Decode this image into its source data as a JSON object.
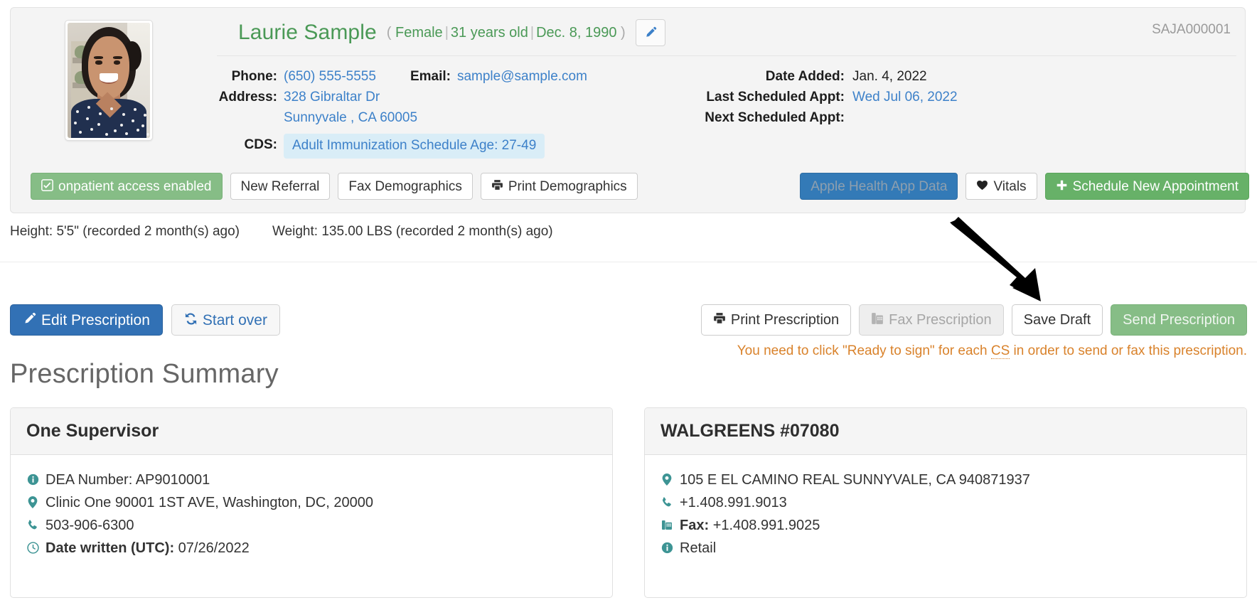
{
  "patient": {
    "name": "Laurie Sample",
    "paren_open": "(",
    "sex": "Female",
    "age": "31 years old",
    "dob": "Dec. 8, 1990",
    "paren_close": ")",
    "chart_id": "SAJA000001",
    "edit_icon": "pencil-icon",
    "avatar_alt": "patient-photo"
  },
  "details_left": {
    "phone_label": "Phone:",
    "phone_value": "(650) 555-5555",
    "email_label": "Email:",
    "email_value": "sample@sample.com",
    "address_label": "Address:",
    "address_line1": "328 Gibraltar Dr",
    "address_line2": "Sunnyvale , CA 60005",
    "cds_label": "CDS:",
    "cds_badge": "Adult Immunization Schedule Age: 27-49"
  },
  "details_right": {
    "date_added_label": "Date Added:",
    "date_added_value": "Jan. 4, 2022",
    "last_appt_label": "Last Scheduled Appt:",
    "last_appt_value": "Wed Jul 06, 2022",
    "next_appt_label": "Next Scheduled Appt:",
    "next_appt_value": ""
  },
  "action_bar": {
    "onpatient": "onpatient access enabled",
    "new_referral": "New Referral",
    "fax_demographics": "Fax Demographics",
    "print_demographics": "Print Demographics",
    "apple_health": "Apple Health App Data",
    "vitals": "Vitals",
    "schedule_appt": "Schedule New Appointment"
  },
  "vitals": {
    "height": "Height: 5'5\" (recorded 2 month(s) ago)",
    "weight": "Weight: 135.00 LBS (recorded 2 month(s) ago)"
  },
  "rx_actions": {
    "edit_prescription": "Edit Prescription",
    "start_over": "Start over",
    "print_prescription": "Print Prescription",
    "fax_prescription": "Fax Prescription",
    "save_draft": "Save Draft",
    "send_prescription": "Send Prescription",
    "warning_pre": "You need to click \"Ready to sign\" for each ",
    "warning_abbr": "CS",
    "warning_post": " in order to send or fax this prescription."
  },
  "section": {
    "title": "Prescription Summary"
  },
  "supervisor_card": {
    "title": "One Supervisor",
    "dea": "DEA Number: AP9010001",
    "address": "Clinic One 90001 1ST AVE, Washington, DC, 20000",
    "phone": "503-906-6300",
    "date_written_label": "Date written (UTC):",
    "date_written_value": "07/26/2022"
  },
  "pharmacy_card": {
    "title": "WALGREENS #07080",
    "address": "105 E EL CAMINO REAL SUNNYVALE, CA 940871937",
    "phone": "+1.408.991.9013",
    "fax_label": "Fax:",
    "fax_value": "+1.408.991.9025",
    "type": "Retail"
  },
  "colors": {
    "patient_name_green": "#4a9956",
    "link_blue": "#3d81c9",
    "warning_orange": "#d9822b",
    "icon_teal": "#3d9494",
    "primary_blue": "#3271b5",
    "success_green": "#67b168"
  }
}
